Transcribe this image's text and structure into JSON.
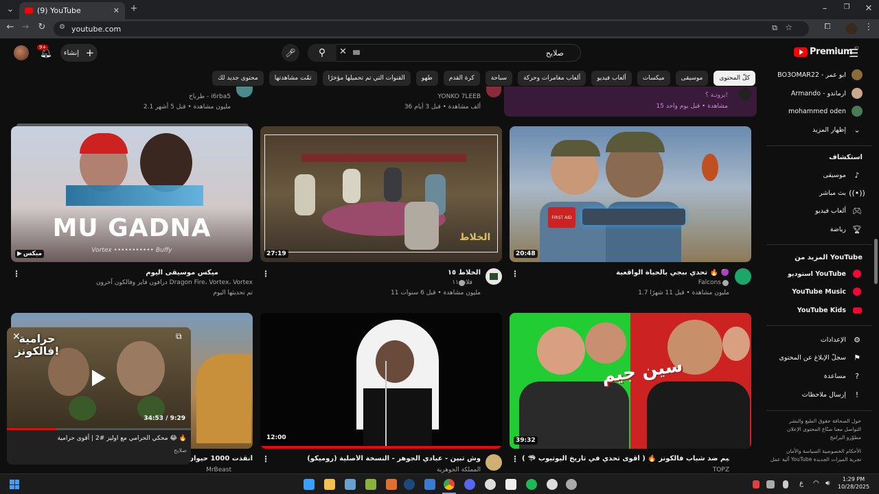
{
  "browser": {
    "tab_title": "(9) YouTube",
    "url": "youtube.com",
    "time": "1:29 PM",
    "date": "10/28/2025",
    "lang": "ع"
  },
  "header": {
    "logo": "Premium",
    "logo_sup": "IQ",
    "search_value": "صلايح",
    "create_label": "إنشاء",
    "notifications_badge": "9+"
  },
  "chips": [
    "كلّ المحتوى",
    "موسيقى",
    "ميكسات",
    "ألعاب فيديو",
    "ألعاب مغامرات وحركة",
    "سباحة",
    "كرة القدم",
    "طهو",
    "القنوات التي تم تحميلها مؤخرًا",
    "تمّت مشاهدتها",
    "محتوى جديد لك"
  ],
  "sidebar": {
    "subscriptions": [
      {
        "label": "BO3OMAR22 - ابو عمر",
        "color": "#8a6b3a"
      },
      {
        "label": "Armando - ارماندو",
        "color": "#c9a98a"
      },
      {
        "label": "mohammed oden",
        "color": "#4a7a5a"
      }
    ],
    "show_more": "إظهار المزيد",
    "explore_title": "استكشاف",
    "explore": [
      {
        "label": "موسيقى",
        "icon": "music-icon"
      },
      {
        "label": "بث مباشر",
        "icon": "live-icon"
      },
      {
        "label": "ألعاب فيديو",
        "icon": "gaming-icon"
      },
      {
        "label": "رياضة",
        "icon": "trophy-icon"
      }
    ],
    "more_title": "المزيد من YouTube",
    "more": [
      {
        "label": "استوديو YouTube"
      },
      {
        "label": "YouTube Music"
      },
      {
        "label": "YouTube Kids"
      }
    ],
    "settings": [
      {
        "label": "الإعدادات",
        "icon": "gear-icon"
      },
      {
        "label": "سجلّ الإبلاغ عن المحتوى",
        "icon": "flag-icon"
      },
      {
        "label": "مساعدة",
        "icon": "help-icon"
      },
      {
        "label": "إرسال ملاحظات",
        "icon": "feedback-icon"
      }
    ],
    "footer1": "حول   الصحافة   حقوق الطبع والنشر",
    "footer2": "التواصل معنا   صنّاع المحتوى   الإعلان",
    "footer3": "مطوّرو البرامج",
    "footer4": "الأحكام   الخصوصية   السياسة والأمان",
    "footer5": "آلية عمل YouTube   تجربة الميزات الجديدة"
  },
  "top_row": [
    {
      "channel": "طرباخ - i6rba5",
      "meta": "2.1 مليون مشاهدة • قبل 5 أشهر"
    },
    {
      "channel": "YONKO 7LEEB",
      "meta": "36 ألف مشاهدة • قبل 3 أيام"
    },
    {
      "title": "يزوتـة ؟!",
      "meta": "15 مشاهدة • قبل يوم واحد"
    }
  ],
  "videos": [
    {
      "title": "تحدي ببجي بالحياة الواقعية 🔥 🟣",
      "channel": "Falcons",
      "meta": "1.7 مليون مشاهدة • قبل 11 شهرًا",
      "duration": "20:48"
    },
    {
      "title": "الخلاط ١٥",
      "channel": "فلاتر ١١",
      "meta": "11 مليون مشاهدة • قبل 6 سنوات",
      "duration": "27:19"
    },
    {
      "title": "ميكس موسيقى اليوم",
      "channel": "درافون فاير وفالكون آخرون Dragon Fire، Vortex، Vortex",
      "meta": "تم تحديثها اليوم",
      "duration": "ميكس"
    },
    {
      "title": "سين جيم ضد شباب فالكونز 🔥 ( أقوى تحدي في تاريخ اليوتيوب 🦈 )",
      "channel": "TOPZ",
      "meta": "",
      "duration": "39:32"
    },
    {
      "title": "وش تبين - عبادي الجوهر - النسخة الأصلية (روميكو)",
      "channel": "المملكة الجوهرية",
      "meta": "",
      "duration": "12:00"
    },
    {
      "title": "أنقذت 1000 حيوان",
      "channel": "MrBeast",
      "meta": "",
      "duration": ""
    }
  ],
  "thumb_text": {
    "mugadna": "MU GADNA",
    "vortex": "Vortex ••••••••••• Buffy",
    "firstaid": "FIRST AID",
    "falcon_arabic": "الخلاط",
    "seen_jeem": "سين جيم"
  },
  "miniplayer": {
    "title": "محكي الحرامي مع اوليز #2 | أقوى حرامية 😂 🔥",
    "channel": "صلايح",
    "time": "34:53 / 9:29",
    "overlay": "حرامية فالكونز!"
  }
}
